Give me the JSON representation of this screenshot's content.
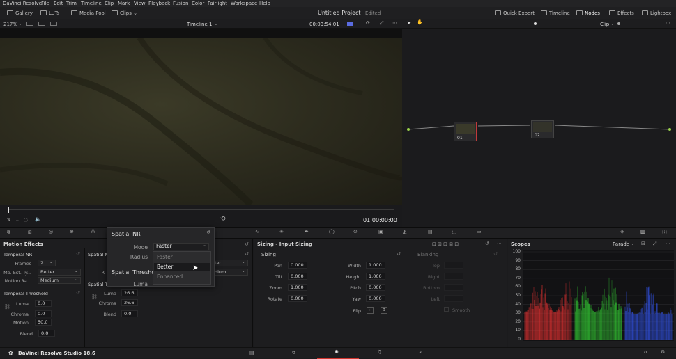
{
  "menubar": {
    "items": [
      "DaVinci Resolve",
      "File",
      "Edit",
      "Trim",
      "Timeline",
      "Clip",
      "Mark",
      "View",
      "Playback",
      "Fusion",
      "Color",
      "Fairlight",
      "Workspace",
      "Help"
    ]
  },
  "topbar": {
    "gallery": "Gallery",
    "luts": "LUTs",
    "media_pool": "Media Pool",
    "clips": "Clips",
    "project_title": "Untitled Project",
    "edited": "Edited",
    "quick_export": "Quick Export",
    "timeline": "Timeline",
    "nodes": "Nodes",
    "effects": "Effects",
    "lightbox": "Lightbox"
  },
  "viewerbar": {
    "zoom": "217%",
    "timeline_name": "Timeline 1",
    "timecode": "00:03:54:01",
    "clip_mode": "Clip"
  },
  "transport": {
    "timecode": "01:00:00:00"
  },
  "nodes": [
    {
      "label": "01"
    },
    {
      "label": "02"
    }
  ],
  "motion_effects": {
    "title": "Motion Effects",
    "temporal_nr": "Temporal NR",
    "frames_label": "Frames",
    "frames_value": "2",
    "mo_est_label": "Mo. Est. Ty...",
    "mo_est_value": "Better",
    "motion_range_label": "Motion Ra...",
    "motion_range_value": "Medium",
    "temporal_threshold": "Temporal Threshold",
    "luma_label": "Luma",
    "luma_value": "0.0",
    "chroma_label": "Chroma",
    "chroma_value": "0.0",
    "motion_label": "Motion",
    "motion_value": "50.0",
    "blend_label": "Blend",
    "blend_value": "0.0",
    "spatial_nr_short": "Spatial N",
    "spatial_t_short": "Spatial T",
    "s_luma_label": "Luma",
    "s_luma_value": "26.6",
    "s_chroma_label": "Chroma",
    "s_chroma_value": "26.6",
    "s_blend_label": "Blend",
    "s_blend_value": "0.0",
    "right_sel1": "ter",
    "right_sel2": "dium",
    "r_short": "R"
  },
  "popup": {
    "title": "Spatial NR",
    "mode_label": "Mode",
    "mode_value": "Faster",
    "radius_label": "Radius",
    "spatial_threshold": "Spatial Thresho",
    "luma_label": "Luma",
    "options": [
      "Faster",
      "Better",
      "Enhanced"
    ],
    "highlighted": "Better"
  },
  "sizing": {
    "title": "Sizing - Input Sizing",
    "section": "Sizing",
    "pan_label": "Pan",
    "pan": "0.000",
    "tilt_label": "Tilt",
    "tilt": "0.000",
    "zoom_label": "Zoom",
    "zoom": "1.000",
    "rotate_label": "Rotate",
    "rotate": "0.000",
    "width_label": "Width",
    "width": "1.000",
    "height_label": "Height",
    "height": "1.000",
    "pitch_label": "Pitch",
    "pitch": "0.000",
    "yaw_label": "Yaw",
    "yaw": "0.000",
    "flip_label": "Flip",
    "blanking": "Blanking",
    "top": "Top",
    "right": "Right",
    "bottom": "Bottom",
    "left": "Left",
    "smooth": "Smooth"
  },
  "scopes": {
    "title": "Scopes",
    "mode": "Parade",
    "axis": [
      "100",
      "90",
      "80",
      "70",
      "60",
      "50",
      "40",
      "30",
      "20",
      "10",
      "0"
    ],
    "colors": {
      "red": "#e03030",
      "green": "#30c030",
      "blue": "#3050e0"
    }
  },
  "bottombar": {
    "app": "DaVinci Resolve Studio 18.6"
  }
}
